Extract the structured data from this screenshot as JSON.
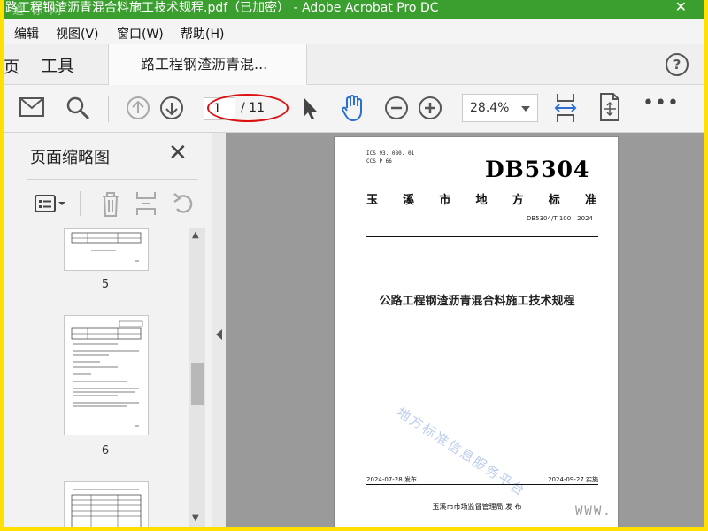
{
  "window": {
    "title": "路工程钢渣沥青混合料施工技术规程.pdf（已加密） - Adobe Acrobat Pro DC",
    "watermark": "道 标 网",
    "close_glyph": "✕"
  },
  "menu": [
    "编辑",
    "视图(V)",
    "窗口(W)",
    "帮助(H)"
  ],
  "tabs": {
    "home": "页",
    "tools": "工具",
    "document": "路工程钢渣沥青混..."
  },
  "toolbar": {
    "current_page": "1",
    "page_total": "/ 11",
    "zoom": "28.4%",
    "more": "•••"
  },
  "left_panel": {
    "title": "页面缩略图",
    "thumbnail_labels": [
      "5",
      "6"
    ]
  },
  "document": {
    "ics_line": "ICS  93. 080. 01",
    "ccs_line": "CCS  P 66",
    "code": "DB5304",
    "local_standard": [
      "玉",
      "溪",
      "市",
      "地",
      "方",
      "标",
      "准"
    ],
    "standard_number": "DB5304/T 100—2024",
    "title": "公路工程钢渣沥青混合料施工技术规程",
    "watermark": "地方标准信息服务平台",
    "publish": "2024-07-28 发布",
    "implement": "2024-09-27 实施",
    "issuer": "玉溪市市场监督管理局    发 布"
  },
  "site_watermark": "WWW.",
  "colors": {
    "titlebar": "#3a9f2f",
    "highlight_oval": "#d11111",
    "page_background": "#9a9a9a"
  },
  "icons": [
    "mail-icon",
    "search-icon",
    "prev-page-icon",
    "next-page-icon",
    "select-cursor-icon",
    "hand-tool-icon",
    "zoom-out-icon",
    "zoom-in-icon",
    "fit-page-icon",
    "rotate-page-icon",
    "help-icon",
    "options-icon",
    "trash-icon",
    "extract-icon",
    "undo-icon"
  ]
}
